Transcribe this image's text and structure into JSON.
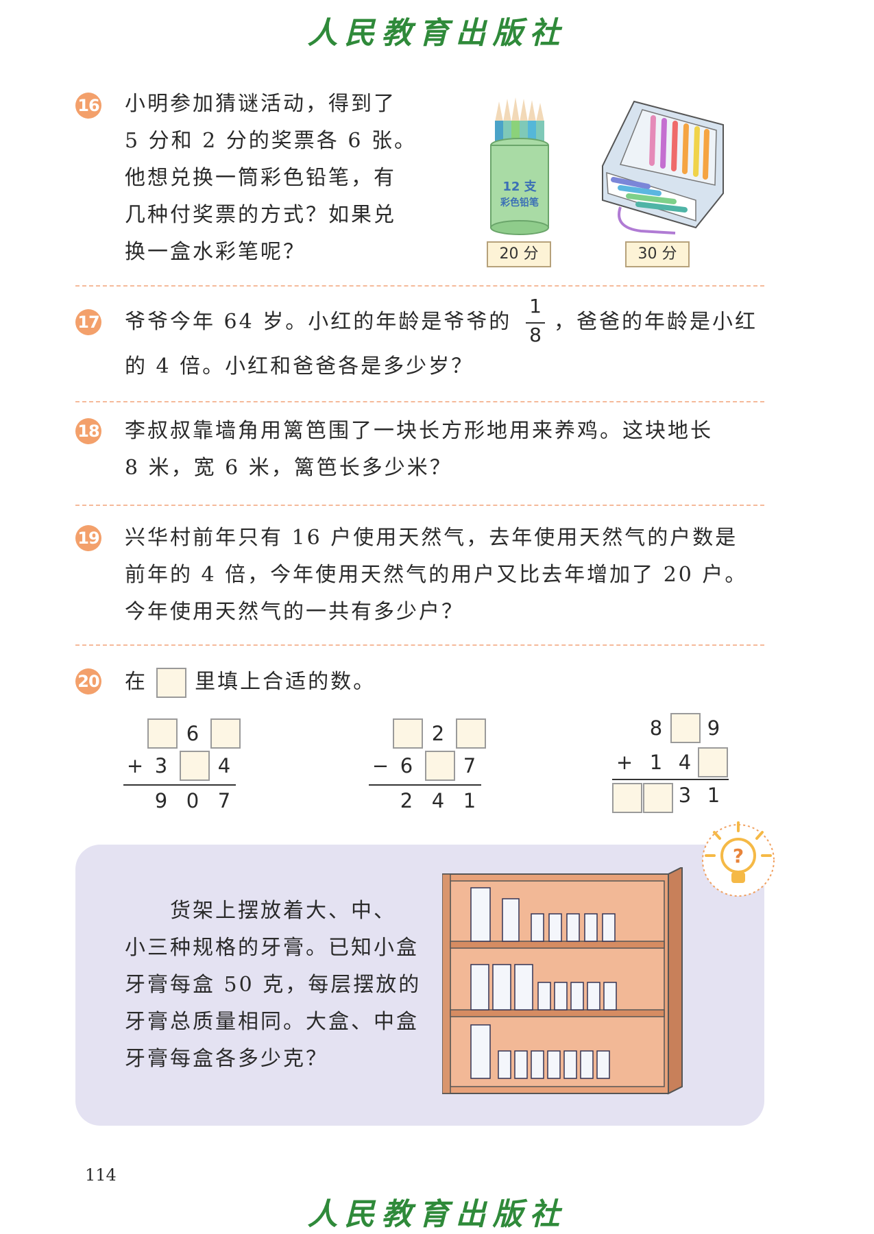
{
  "publisher": "人民教育出版社",
  "page_number": "114",
  "q16": {
    "num": "16",
    "lines": [
      "小明参加猜谜活动，得到了",
      "5 分和 2 分的奖票各 6 张。",
      "他想兑换一筒彩色铅笔，有",
      "几种付奖票的方式？如果兑",
      "换一盒水彩笔呢？"
    ],
    "pencil_label1": "12 支",
    "pencil_label2": "彩色铅笔",
    "price1": "20 分",
    "price2": "30 分"
  },
  "q17": {
    "num": "17",
    "line1_a": "爷爷今年 64 岁。小红的年龄是爷爷的",
    "frac_num": "1",
    "frac_den": "8",
    "line1_b": "，爸爸的年龄是小红",
    "line2": "的 4 倍。小红和爸爸各是多少岁？"
  },
  "q18": {
    "num": "18",
    "lines": [
      "李叔叔靠墙角用篱笆围了一块长方形地用来养鸡。这块地长",
      "8 米，宽 6 米，篱笆长多少米？"
    ]
  },
  "q19": {
    "num": "19",
    "lines": [
      "兴华村前年只有 16 户使用天然气，去年使用天然气的户数是",
      "前年的 4 倍，今年使用天然气的用户又比去年增加了 20 户。",
      "今年使用天然气的一共有多少户？"
    ]
  },
  "q20": {
    "num": "20",
    "prefix": "在",
    "suffix": "里填上合适的数。",
    "p1": {
      "r1_mid": "6",
      "r2_op": "+",
      "r2_a": "3",
      "r2_c": "4",
      "res": [
        "9",
        "0",
        "7"
      ]
    },
    "p2": {
      "r1_mid": "2",
      "r2_op": "−",
      "r2_a": "6",
      "r2_c": "7",
      "res": [
        "2",
        "4",
        "1"
      ]
    },
    "p3": {
      "r1_a": "8",
      "r1_c": "9",
      "r2_op": "+",
      "r2_a": "1",
      "r2_b": "4",
      "res_a": "3",
      "res_b": "1"
    }
  },
  "thinking": {
    "lines": [
      "货架上摆放着大、中、",
      "小三种规格的牙膏。已知小盒",
      "牙膏每盒 50 克，每层摆放的",
      "牙膏总质量相同。大盒、中盒",
      "牙膏每盒各多少克？"
    ],
    "icon_char": "?"
  }
}
